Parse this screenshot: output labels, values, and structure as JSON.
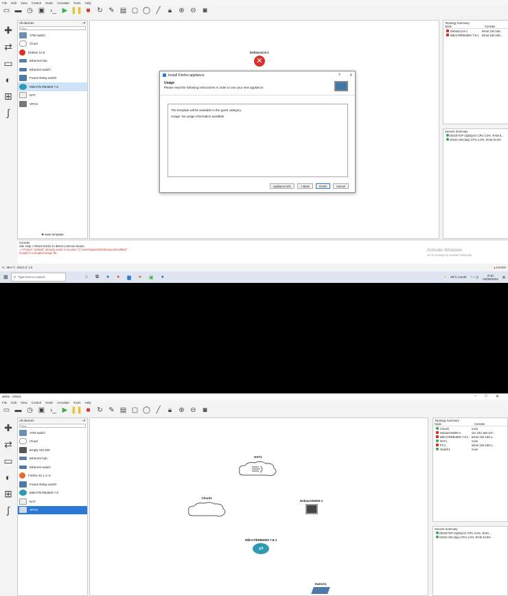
{
  "shotA": {
    "menu": [
      "File",
      "Edit",
      "View",
      "Control",
      "Node",
      "Annotate",
      "Tools",
      "Help"
    ],
    "devices_title": "All devices",
    "filter_placeholder": "Filter",
    "devices": [
      "ATM switch",
      "Cloud",
      "Debian 12.6",
      "Ethernet hub",
      "Ethernet switch",
      "Frame Relay switch",
      "MikroTik RB4500 7.8",
      "NAT",
      "VPCS"
    ],
    "new_template": "New template",
    "canvas_node": "Debian12.6-1",
    "dialog": {
      "title": "Install Firefox appliance",
      "help": "?",
      "close": "X",
      "heading": "Usage",
      "subheading": "Please read the following instructions in order to use your new appliance.",
      "line1": "The template will be available in the guest category.",
      "line2": "Usage: No usage information available",
      "buttons": [
        "Appliance info",
        "< Back",
        "Finish",
        "Cancel"
      ]
    },
    "topology": {
      "title": "Topology Summary",
      "col_node": "Node",
      "col_console": "Console",
      "rows": [
        {
          "name": "Debian12.6-1",
          "console": "telnet 192.168..."
        },
        {
          "name": "MikroTikRB4500 7.8-1",
          "console": "telnet 192.168..."
        }
      ]
    },
    "servers": {
      "title": "Servers Summary",
      "rows": [
        "DESKTOP-2QDQAO CPU 2.5%, RAM 8...",
        "GNS3 VM (day) CPU 1.5%, RAM 10.0%"
      ]
    },
    "console": {
      "title": "Console",
      "line1": "Use Help > GNS3 Doctor to detect common issues.",
      "line2": "=> Project \"untitled\" already exists in location \"C:\\Users\\paus\\GNS3\\projects\\untitled\"",
      "line3": "Invalid or corrupted image file"
    },
    "activate": {
      "title": "Activate Windows",
      "sub": "Go to Settings to activate Windows."
    },
    "status_left": "X: -38.0 Y: -252.0 Z: 2.0",
    "status_right": "2 errors",
    "taskbar": {
      "search": "Type here to search",
      "weather": "26°C Cerah",
      "time": "8:10",
      "date": "04/09/2024"
    }
  },
  "shotB": {
    "title": "defan - GNS3",
    "window_controls": [
      "−",
      "□",
      "✕"
    ],
    "menu": [
      "File",
      "Edit",
      "View",
      "Control",
      "Node",
      "Annotate",
      "Tools",
      "Help"
    ],
    "devices_title": "All devices",
    "filter_placeholder": "Filter",
    "devices": [
      "ATM switch",
      "Cloud",
      "Empty VM 300",
      "Ethernet hub",
      "Ethernet switch",
      "Firefox 31.1.1~2",
      "Frame Relay switch",
      "MikroTik RB4500 7.8",
      "NAT",
      "VPCS"
    ],
    "nodes": {
      "nat": "NAT1",
      "cloud": "Cloud1",
      "debian": "DebianVM300-1",
      "mikrotik": "MikroTikRB4500 7.8-1",
      "switch": "Switch1"
    },
    "topology": {
      "title": "Topology Summary",
      "col_node": "Node",
      "col_console": "Console",
      "rows": [
        {
          "name": "Cloud1",
          "console": "none"
        },
        {
          "name": "DebianVM300-1",
          "console": "vnc 192.168.107..."
        },
        {
          "name": "MikroTikRB4500 7.8-1",
          "console": "telnet 192.168.1..."
        },
        {
          "name": "NAT1",
          "console": "none"
        },
        {
          "name": "PC1",
          "console": "telnet 192.168.1..."
        },
        {
          "name": "Switch1",
          "console": "none"
        }
      ]
    },
    "servers": {
      "title": "Servers Summary",
      "rows": [
        "DESKTOP-2QDQAO CPU 3.2%, RAM ...",
        "GNS3 VM (day) CPU 1.0%, RAM 10.9%"
      ]
    }
  }
}
